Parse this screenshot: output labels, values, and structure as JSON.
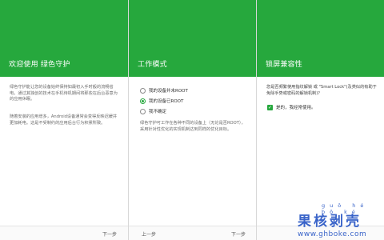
{
  "panels": [
    {
      "title": "欢迎使用 绿色守护",
      "paragraphs": [
        "绿色守护能让您的设备始终保持如最初入手时般的流畅省电。通过其独创的技术在手机待机期间将那些在后台恶意为的应用休眠。",
        "随着安装的应用增多，Android设备通常会变得反映迟缓并更加耗电。这是不受制约的应用后台行为积累所致。"
      ],
      "nav": {
        "next": "下一步"
      }
    },
    {
      "title": "工作模式",
      "options": [
        {
          "label": "我的设备并未ROOT",
          "selected": false
        },
        {
          "label": "我的设备已ROOT",
          "selected": true
        },
        {
          "label": "我不确定",
          "selected": false
        }
      ],
      "description": "绿色守护可工作在各种不同的设备上（无论是否ROOT），采用针对性优化的实现机制达到同样的优化目标。",
      "nav": {
        "prev": "上一步",
        "next": "下一步"
      }
    },
    {
      "title": "锁屏兼容性",
      "question": "您是否频繁使用指纹解锁 或 \"Smart Lock\"(及类似的有助于免除手势或密码的解锁机制)？",
      "checkbox": {
        "label": "是的，我经常使用。",
        "checked": true
      }
    }
  ],
  "watermark": {
    "pinyin": "guǒ hé bō ké",
    "title": "果核剥壳",
    "url": "www.ghboke.com"
  },
  "colors": {
    "header_green": "#26a83d",
    "watermark_blue": "#3a64c9"
  }
}
